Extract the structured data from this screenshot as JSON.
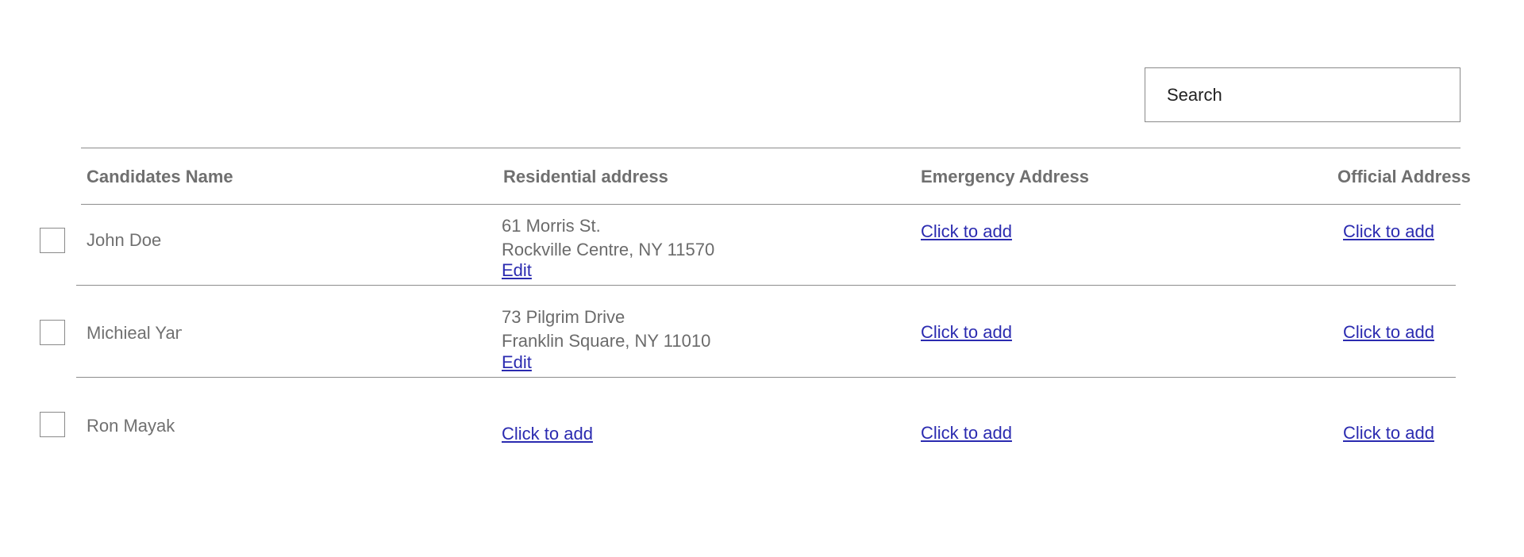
{
  "search": {
    "label": "Search"
  },
  "table": {
    "headers": {
      "name": "Candidates Name",
      "residential": "Residential address",
      "emergency": "Emergency Address",
      "official": "Official Address"
    },
    "rows": [
      {
        "name": "John Doe",
        "residential_line1": "61 Morris St.",
        "residential_line2": "Rockville Centre, NY 11570",
        "residential_edit": "Edit",
        "emergency": "Click to add",
        "official": "Click to add"
      },
      {
        "name": "Michieal Yan",
        "residential_line1": "73 Pilgrim Drive",
        "residential_line2": "Franklin Square, NY 11010",
        "residential_edit": "Edit",
        "emergency": "Click to add",
        "official": "Click to add"
      },
      {
        "name": "Ron Mayak",
        "residential_add": "Click to add",
        "emergency": "Click to add",
        "official": "Click to add"
      }
    ]
  }
}
